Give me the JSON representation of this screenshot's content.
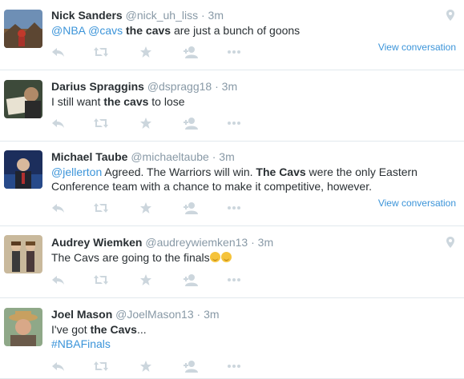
{
  "tweets": [
    {
      "name": "Nick Sanders",
      "handle": "@nick_uh_liss",
      "dot": "·",
      "time": "3m",
      "parts": [
        {
          "text": "@NBA",
          "style": "link"
        },
        {
          "text": " ",
          "style": "plain"
        },
        {
          "text": "@cavs",
          "style": "link"
        },
        {
          "text": " ",
          "style": "plain"
        },
        {
          "text": "the cavs",
          "style": "bold"
        },
        {
          "text": " are just a bunch of goons",
          "style": "plain"
        }
      ],
      "view_conversation": "View conversation",
      "has_geo": true
    },
    {
      "name": "Darius Spraggins",
      "handle": "@dspragg18",
      "dot": "·",
      "time": "3m",
      "parts": [
        {
          "text": "I still want ",
          "style": "plain"
        },
        {
          "text": "the cavs",
          "style": "bold"
        },
        {
          "text": " to lose",
          "style": "plain"
        }
      ],
      "view_conversation": "",
      "has_geo": false
    },
    {
      "name": "Michael Taube",
      "handle": "@michaeltaube",
      "dot": "·",
      "time": "3m",
      "parts": [
        {
          "text": "@jellerton",
          "style": "link"
        },
        {
          "text": " Agreed. The Warriors will win. ",
          "style": "plain"
        },
        {
          "text": "The Cavs",
          "style": "bold"
        },
        {
          "text": " were the only Eastern Conference team with a chance to make it competitive, however.",
          "style": "plain"
        }
      ],
      "view_conversation": "View conversation",
      "has_geo": false
    },
    {
      "name": "Audrey Wiemken",
      "handle": "@audreywiemken13",
      "dot": "·",
      "time": "3m",
      "parts": [
        {
          "text": "The Cavs are going to the finals",
          "style": "plain"
        }
      ],
      "emoji_count": 2,
      "view_conversation": "",
      "has_geo": true
    },
    {
      "name": "Joel Mason",
      "handle": "@JoelMason13",
      "dot": "·",
      "time": "3m",
      "parts": [
        {
          "text": "I've got ",
          "style": "plain"
        },
        {
          "text": "the Cavs",
          "style": "bold"
        },
        {
          "text": "...",
          "style": "plain"
        },
        {
          "text": "\n",
          "style": "break"
        },
        {
          "text": "#NBAFinals",
          "style": "link"
        }
      ],
      "view_conversation": "",
      "has_geo": false
    }
  ],
  "actions": [
    "reply-icon",
    "retweet-icon",
    "favorite-icon",
    "follow-icon",
    "more-icon"
  ],
  "colors": {
    "link": "#3b94d9",
    "muted": "#8899a6",
    "icon": "#ccd6dd",
    "divider": "#e1e8ed",
    "text": "#292f33"
  }
}
